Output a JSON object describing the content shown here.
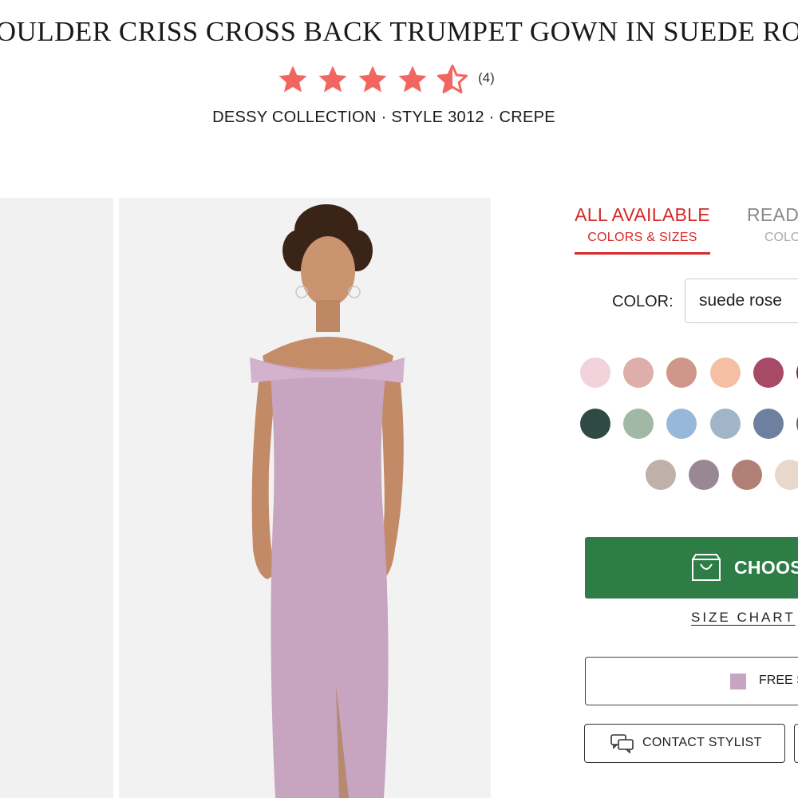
{
  "product": {
    "title": "OULDER CRISS CROSS BACK TRUMPET GOWN IN SUEDE RO",
    "rating": 4.5,
    "review_count": "(4)",
    "meta": "DESSY COLLECTION · STYLE 3012 · CREPE"
  },
  "tabs": {
    "all_available_line1": "ALL AVAILABLE",
    "all_available_line2": "COLORS & SIZES",
    "ready_line1": "READ",
    "ready_line2": "COLO"
  },
  "color_picker": {
    "label": "COLOR:",
    "selected": "suede rose",
    "swatches": [
      "#f2d3dc",
      "#ddaeaa",
      "#cf968a",
      "#f5bfa6",
      "#a64a68",
      "#7a2a3a",
      "#2f4a45",
      "#a1b8a6",
      "#98b8da",
      "#a2b4c8",
      "#6e80a0",
      "#4a6a7a",
      "#bfb1aa",
      "#9a8794",
      "#b08077",
      "#e8d8cc"
    ]
  },
  "actions": {
    "choose_label": "CHOOSE",
    "size_chart": "SIZE CHART",
    "free_label": "FREE S",
    "contact_label": "CONTACT STYLIST"
  },
  "colors": {
    "accent_red": "#d62828",
    "star": "#f26660",
    "choose_green": "#2e7d46",
    "dress": "#c7a4c0"
  }
}
